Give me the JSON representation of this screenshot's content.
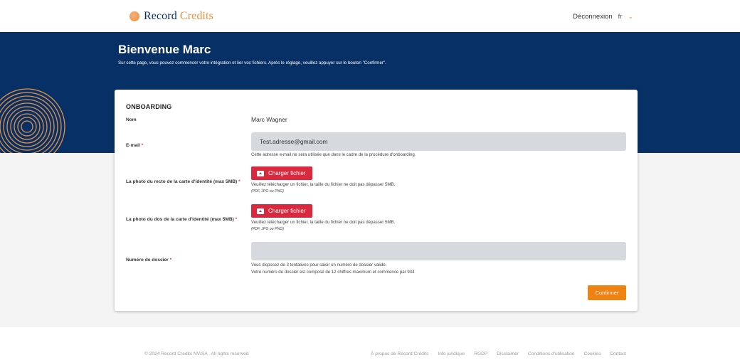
{
  "header": {
    "logo_main": "Record",
    "logo_accent": "Credits",
    "logout_label": "Déconnexion",
    "language": "fr"
  },
  "hero": {
    "title": "Bienvenue Marc",
    "subtitle": "Sur cette page, vous pouvez commencer votre intégration et lier vos fichiers. Après le réglage, veuillez appuyer sur le bouton \"Confirmer\"."
  },
  "form": {
    "title": "ONBOARDING",
    "name": {
      "label": "Nom",
      "value": "Marc Wagner"
    },
    "email": {
      "label": "E-mail",
      "required_mark": "*",
      "value": "Test.adresse@gmail.com",
      "help": "Cette adresse e-mail ne sera utilisée que dans le cadre de la procédure d'onboarding."
    },
    "id_front": {
      "label": "La photo du recto de la carte d'identité (max 5MB)",
      "required_mark": "*",
      "button_label": "Charger fichier",
      "help": "Veuillez télécharger un fichier, la taille du fichier ne doit pas dépasser 5MB.",
      "formats": "(PDF, JPG ou PNG)"
    },
    "id_back": {
      "label": "La photo du dos de la carte d'identité (max 5MB)",
      "required_mark": "*",
      "button_label": "Charger fichier",
      "help": "Veuillez télécharger un fichier, la taille du fichier ne doit pas dépasser 5MB.",
      "formats": "(PDF, JPG ou PNG)"
    },
    "dossier": {
      "label": "Numéro de dossier",
      "required_mark": "*",
      "value": "",
      "help_1": "Vous disposez de 3 tentatives pour saisir un numéro de dossier valide.",
      "help_2": "Votre numéro de dossier est composé de 12 chiffres maximum et commence par 934"
    },
    "confirm_label": "Confirmer"
  },
  "footer": {
    "copyright": "© 2024 Record Credits NV/SA . All rights reserved",
    "links": [
      "À propos de Record Crédits",
      "Info juridique",
      "RGDP",
      "Disclaimer",
      "Conditions d'utilisation",
      "Cookies",
      "Contact"
    ]
  },
  "colors": {
    "brand_blue": "#073166",
    "brand_orange": "#e8903f",
    "upload_red": "#d8293f",
    "confirm_orange": "#ee8213"
  },
  "icons": [
    "logo-mark-icon",
    "chevron-down-icon",
    "upload-folder-icon",
    "fingerprint-decoration"
  ]
}
